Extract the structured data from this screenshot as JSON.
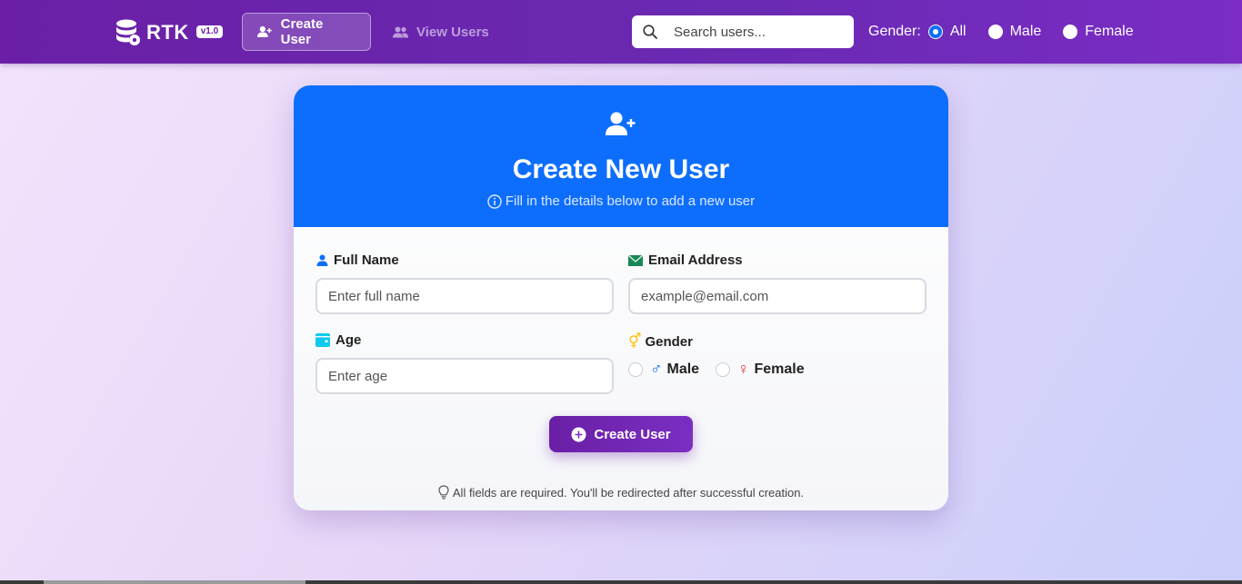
{
  "brand": {
    "name": "RTK",
    "version": "v1.0",
    "icon": "database-gear-icon"
  },
  "nav": {
    "create_label": "Create User",
    "view_label": "View Users"
  },
  "search": {
    "placeholder": "Search users..."
  },
  "gender_filter": {
    "label": "Gender:",
    "options": [
      "All",
      "Male",
      "Female"
    ],
    "selected": "All"
  },
  "form": {
    "title": "Create New User",
    "subtitle": "Fill in the details below to add a new user",
    "full_name": {
      "label": "Full Name",
      "placeholder": "Enter full name",
      "value": ""
    },
    "email": {
      "label": "Email Address",
      "placeholder": "example@email.com",
      "value": ""
    },
    "age": {
      "label": "Age",
      "placeholder": "Enter age",
      "value": ""
    },
    "gender": {
      "label": "Gender",
      "options": [
        "Male",
        "Female"
      ],
      "male_symbol": "♂",
      "female_symbol": "♀"
    },
    "submit_label": "Create User",
    "footnote": "All fields are required. You'll be redirected after successful creation."
  },
  "colors": {
    "navbar": "#6a1fa6",
    "header": "#0d6efd",
    "accent": "#7b2fc2",
    "email_icon": "#198754",
    "age_icon": "#0dcaf0",
    "gender_icon": "#ffc107",
    "male": "#0d6efd",
    "female": "#dc3545"
  }
}
